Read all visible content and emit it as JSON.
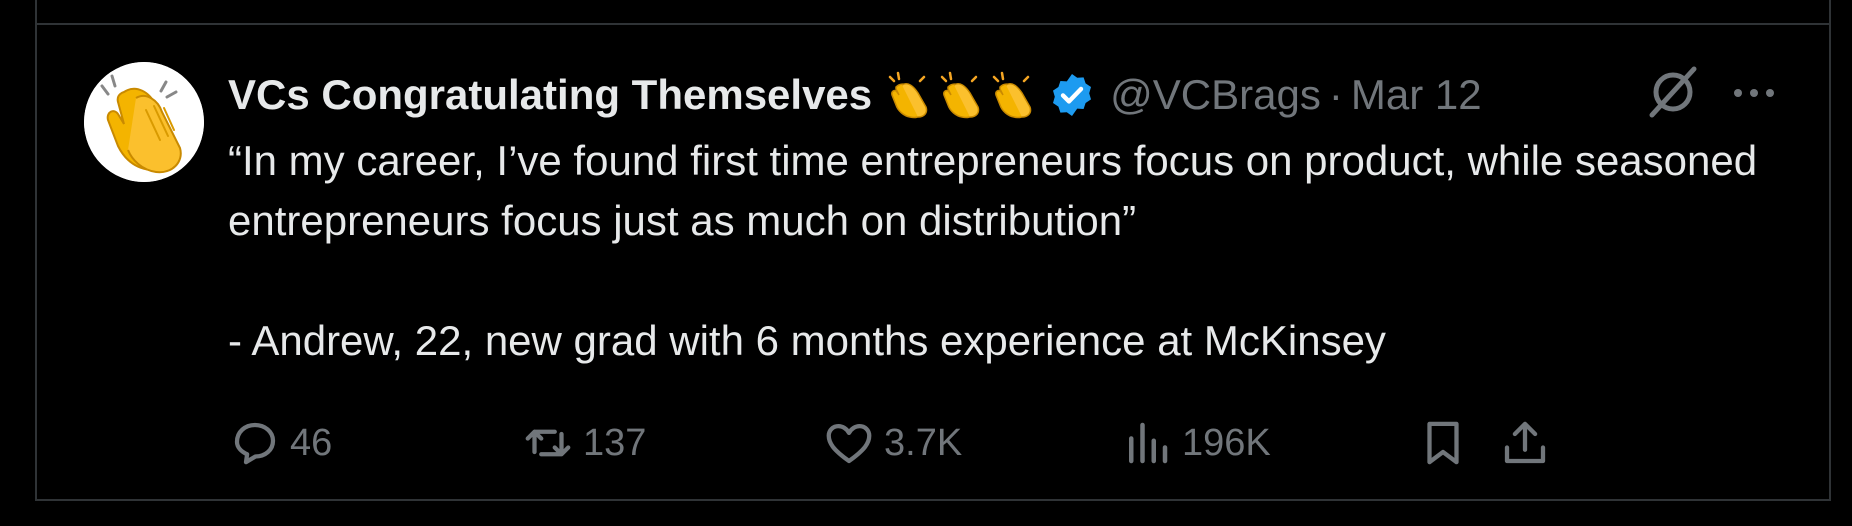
{
  "tweet": {
    "display_name": "VCs Congratulating Themselves",
    "name_emojis": [
      "clapping-hands",
      "clapping-hands",
      "clapping-hands"
    ],
    "verified": true,
    "handle": "@VCBrags",
    "separator": "·",
    "date": "Mar 12",
    "text_lines": [
      "“In my career, I’ve found first time entrepreneurs focus on product, while seasoned entrepreneurs focus just as much on distribution”",
      "- Andrew, 22, new grad with 6 months experience at McKinsey"
    ],
    "actions": {
      "replies": "46",
      "reposts": "137",
      "likes": "3.7K",
      "views": "196K"
    }
  },
  "colors": {
    "background": "#000000",
    "text": "#e7e9ea",
    "muted": "#71767b",
    "border": "#2f3336",
    "verified": "#1d9bf0"
  }
}
